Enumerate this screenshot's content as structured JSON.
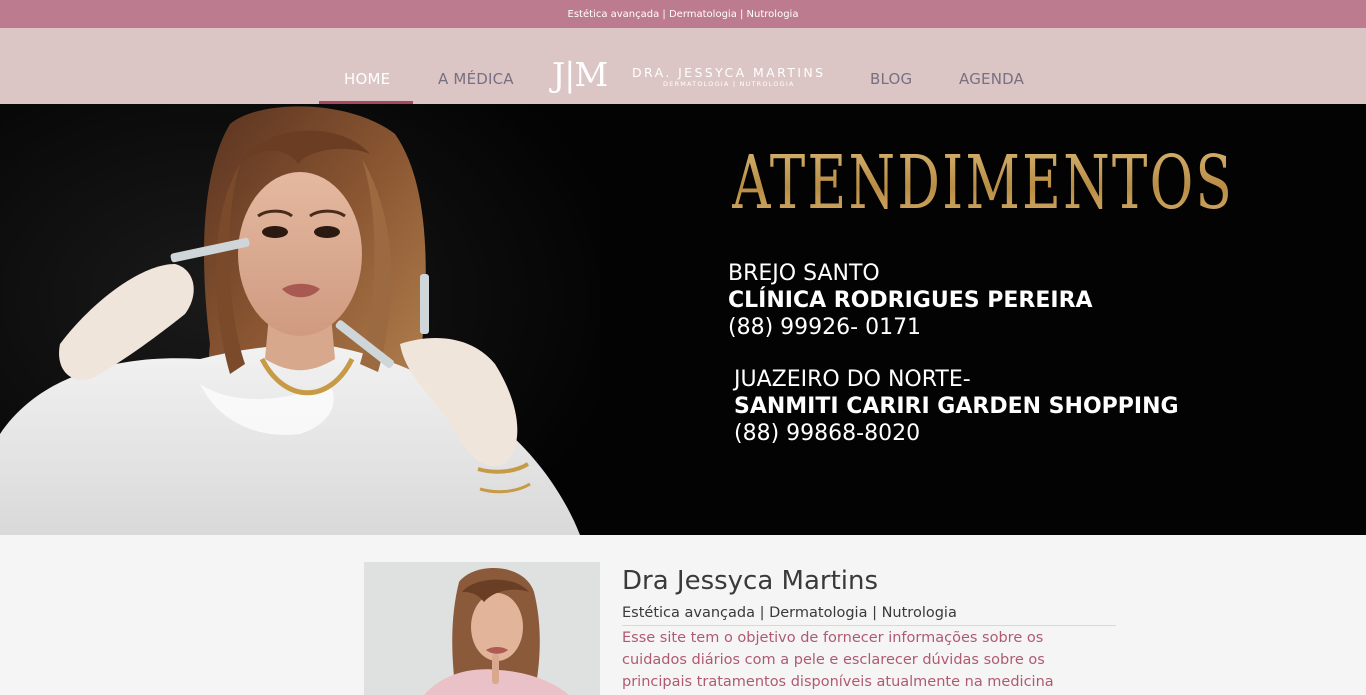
{
  "topbar": {
    "text": "Estética avançada | Dermatologia | Nutrologia"
  },
  "nav": {
    "items": [
      {
        "label": "HOME",
        "active": true
      },
      {
        "label": "A MÉDICA",
        "active": false
      },
      {
        "label": "BLOG",
        "active": false
      },
      {
        "label": "AGENDA",
        "active": false
      }
    ],
    "logo": {
      "mark": "J|M",
      "name": "DRA. JESSYCA MARTINS",
      "subtitle": "DERMATOLOGIA | NUTROLOGIA"
    }
  },
  "hero": {
    "title": "ATENDIMENTOS",
    "locations": [
      {
        "city": "BREJO SANTO",
        "clinic": "CLÍNICA RODRIGUES PEREIRA",
        "phone": "(88) 99926- 0171"
      },
      {
        "city": "JUAZEIRO DO NORTE-",
        "clinic": "SANMITI CARIRI GARDEN SHOPPING",
        "phone": "(88) 99868-8020"
      }
    ]
  },
  "about": {
    "name": "Dra Jessyca Martins",
    "tags": "Estética avançada | Dermatologia | Nutrologia",
    "description": "Esse site tem o objetivo de fornecer informações sobre os cuidados diários com a pele e esclarecer dúvidas sobre os principais tratamentos disponíveis atualmente na medicina"
  },
  "colors": {
    "topbar": "#bd7b8f",
    "nav_bg": "#dcc5c5",
    "nav_active_underline": "#a8475f",
    "hero_bg": "#030303",
    "gold": "#c9a461",
    "description_text": "#b05a72"
  }
}
